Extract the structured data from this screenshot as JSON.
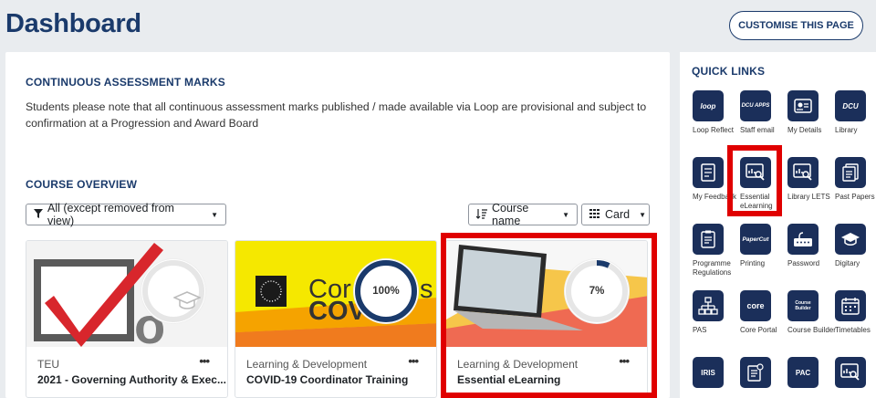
{
  "header": {
    "title": "Dashboard",
    "customise_label": "CUSTOMISE THIS PAGE"
  },
  "assessment": {
    "heading": "CONTINUOUS ASSESSMENT MARKS",
    "text": "Students please note that all continuous assessment marks published / made available via Loop are provisional and subject to confirmation at a Progression and Award Board"
  },
  "course_overview": {
    "heading": "COURSE OVERVIEW",
    "filter_label": "All (except removed from view)",
    "sort_label": "Course name",
    "view_label": "Card",
    "menu_glyph": "•••",
    "cards": [
      {
        "category": "TEU",
        "name": "2021 - Governing Authority & Exec...",
        "progress_label": "",
        "progress": null
      },
      {
        "category": "Learning & Development",
        "name": "COVID-19 Coordinator Training",
        "progress_label": "100%",
        "progress": 1.0,
        "banner_text_1": "Cor",
        "banner_text_2": "COV",
        "banner_text_3": "s"
      },
      {
        "category": "Learning & Development",
        "name": "Essential eLearning",
        "progress_label": "7%",
        "progress": 0.07
      }
    ]
  },
  "quick_links": {
    "heading": "QUICK LINKS",
    "items": [
      {
        "label": "Loop Reflect",
        "icon": "loop-reflect-icon",
        "tile_text": "loop"
      },
      {
        "label": "Staff email",
        "icon": "staff-email-icon",
        "tile_text": "DCU APPS"
      },
      {
        "label": "My Details",
        "icon": "id-card-icon"
      },
      {
        "label": "Library",
        "icon": "library-icon",
        "tile_text": "DCU"
      },
      {
        "label": "My Feedback",
        "icon": "feedback-icon"
      },
      {
        "label": "Essential eLearning",
        "icon": "elearning-icon"
      },
      {
        "label": "Library LETS",
        "icon": "library-lets-icon"
      },
      {
        "label": "Past Papers",
        "icon": "past-papers-icon"
      },
      {
        "label": "Programme Regulations",
        "icon": "regulations-icon"
      },
      {
        "label": "Printing",
        "icon": "printing-icon",
        "tile_text": "PaperCut"
      },
      {
        "label": "Password",
        "icon": "password-icon"
      },
      {
        "label": "Digitary",
        "icon": "digitary-icon"
      },
      {
        "label": "PAS",
        "icon": "pas-icon"
      },
      {
        "label": "Core Portal",
        "icon": "core-portal-icon",
        "tile_text": "core"
      },
      {
        "label": "Course Builder",
        "icon": "course-builder-icon",
        "tile_text": "Course Builder"
      },
      {
        "label": "Timetables",
        "icon": "timetables-icon"
      },
      {
        "label": "",
        "icon": "iris-icon",
        "tile_text": "IRIS"
      },
      {
        "label": "",
        "icon": "document-icon"
      },
      {
        "label": "",
        "icon": "pac-icon",
        "tile_text": "PAC"
      },
      {
        "label": "",
        "icon": "search-report-icon"
      }
    ]
  },
  "colors": {
    "brand": "#1a3a6b",
    "tile": "#1b2f5a",
    "highlight": "#e00000"
  }
}
